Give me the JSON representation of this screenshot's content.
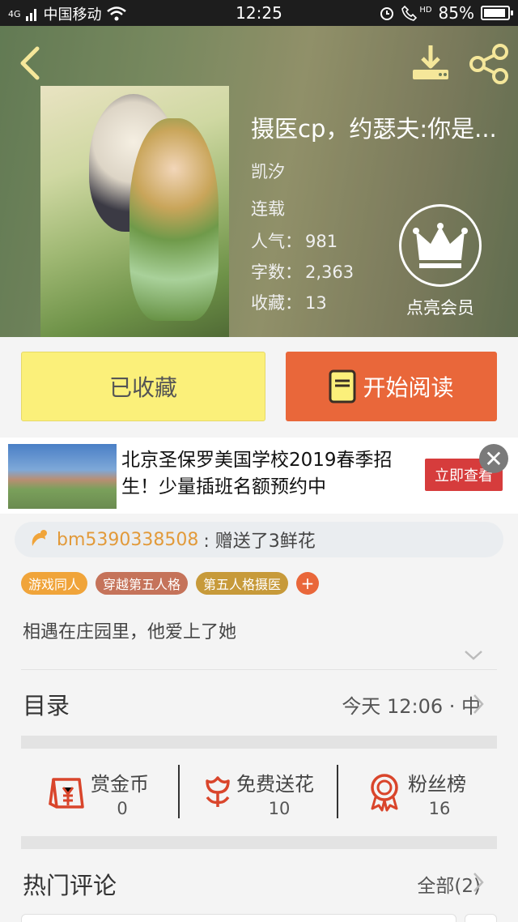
{
  "status_bar": {
    "carrier": "中国移动",
    "network": "4G",
    "time": "12:25",
    "hd": "HD",
    "battery": "85%"
  },
  "book": {
    "title": "摄医cp，约瑟夫:你是...",
    "author": "凯汐",
    "status": "连载",
    "popularity_label": "人气：",
    "popularity": "981",
    "words_label": "字数：",
    "words": "2,363",
    "favorites_label": "收藏：",
    "favorites": "13"
  },
  "vip": {
    "label": "点亮会员"
  },
  "actions": {
    "favorited": "已收藏",
    "start_reading": "开始阅读"
  },
  "ad": {
    "text": "北京圣保罗美国学校2019春季招生！少量插班名额预约中",
    "button": "立即查看",
    "close": "✕"
  },
  "gift": {
    "user": "bm5390338508",
    "message": ": 赠送了3鲜花"
  },
  "tags": [
    {
      "label": "游戏同人",
      "color": "#f0a43a"
    },
    {
      "label": "穿越第五人格",
      "color": "#c5735a"
    },
    {
      "label": "第五人格摄医",
      "color": "#c79a3a"
    }
  ],
  "tag_add": "+",
  "intro": "相遇在庄园里，他爱上了她",
  "toc": {
    "label": "目录",
    "updated": "今天 12:06 · 中"
  },
  "rewards": [
    {
      "label": "赏金币",
      "value": "0"
    },
    {
      "label": "免费送花",
      "value": "10"
    },
    {
      "label": "粉丝榜",
      "value": "16"
    }
  ],
  "comments": {
    "label": "热门评论",
    "all": "全部(2)"
  },
  "colors": {
    "accent": "#e9673a",
    "favorite_button": "#fbf07a",
    "icon_red": "#d9452b",
    "gift_user": "#e29a3a"
  }
}
